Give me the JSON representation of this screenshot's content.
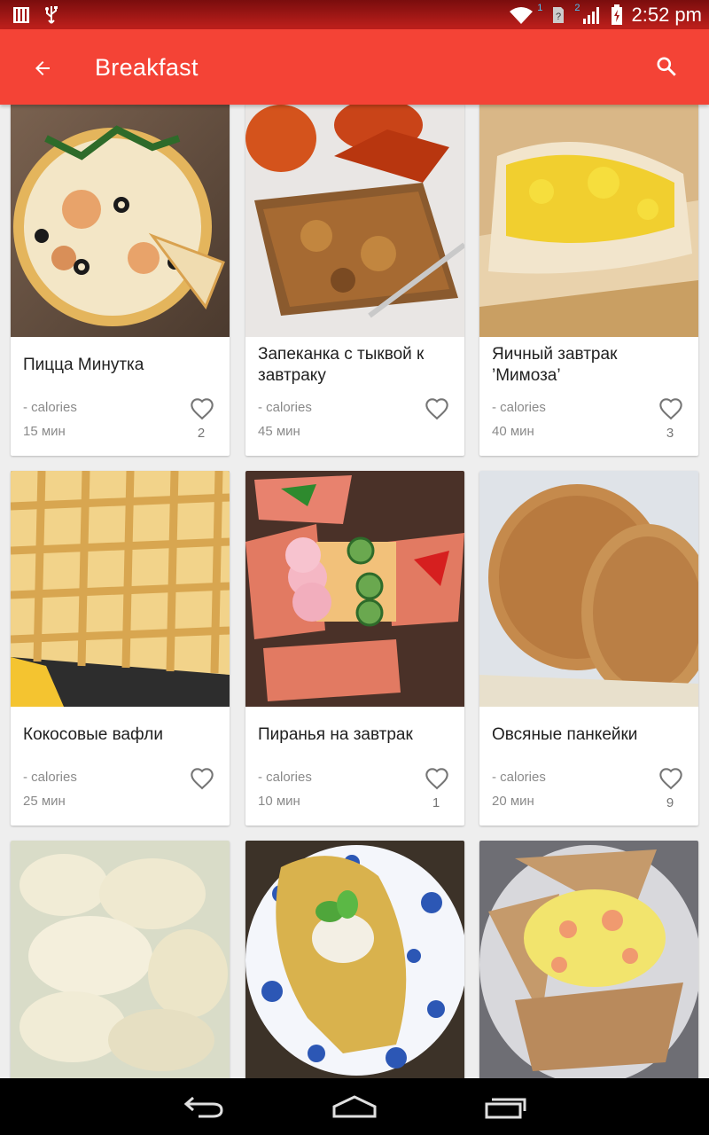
{
  "status_bar": {
    "time": "2:52 pm",
    "sim1_label": "1",
    "sim2_label": "2",
    "icons": [
      "sim-card-icon",
      "usb-icon",
      "wifi-icon",
      "sim-signal-icon",
      "cell-signal-icon",
      "battery-charging-icon"
    ]
  },
  "app_bar": {
    "title": "Breakfast",
    "color": "#f44336",
    "icons": [
      "back-arrow-icon",
      "search-icon"
    ]
  },
  "recipes": [
    {
      "name": "Пицца Минутка",
      "calories": "- calories",
      "time": "15 мин",
      "likes": "2"
    },
    {
      "name": "Запеканка с тыквой к завтраку",
      "calories": "- calories",
      "time": "45 мин",
      "likes": ""
    },
    {
      "name": "Яичный завтрак ’Мимоза’",
      "calories": "- calories",
      "time": "40 мин",
      "likes": "3"
    },
    {
      "name": "Кокосовые вафли",
      "calories": "- calories",
      "time": "25 мин",
      "likes": ""
    },
    {
      "name": "Пиранья на завтрак",
      "calories": "- calories",
      "time": "10 мин",
      "likes": "1"
    },
    {
      "name": "Овсяные панкейки",
      "calories": "- calories",
      "time": "20 мин",
      "likes": "9"
    },
    {
      "name": "",
      "calories": "",
      "time": "",
      "likes": ""
    },
    {
      "name": "",
      "calories": "",
      "time": "",
      "likes": ""
    },
    {
      "name": "",
      "calories": "",
      "time": "",
      "likes": ""
    }
  ],
  "nav_bar": {
    "icons": [
      "back-nav-icon",
      "home-nav-icon",
      "recents-nav-icon"
    ]
  }
}
